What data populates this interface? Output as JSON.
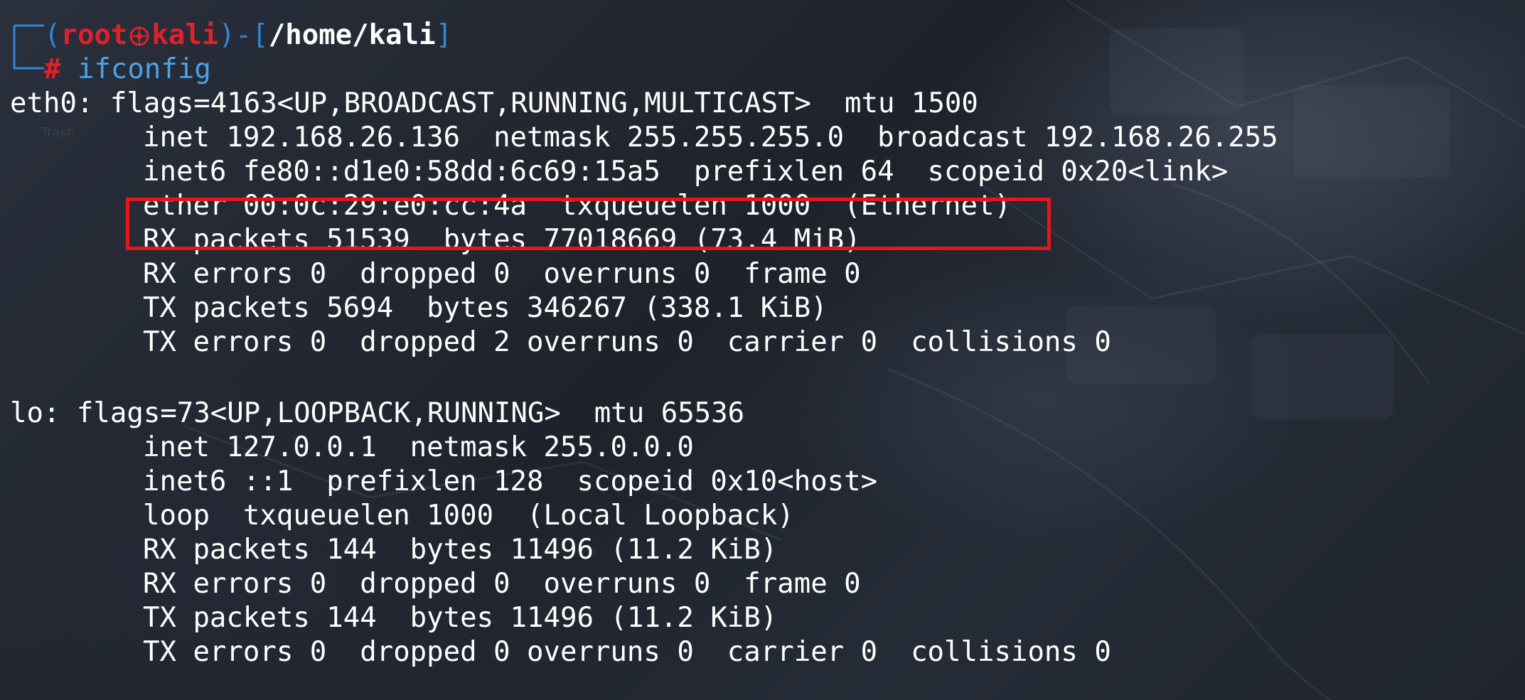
{
  "prompt": {
    "user": "root",
    "separator_icon": "skull-at-icon",
    "host": "kali",
    "cwd": "/home/kali",
    "symbol": "#",
    "command": "ifconfig"
  },
  "output": {
    "eth0": {
      "header": "eth0: flags=4163<UP,BROADCAST,RUNNING,MULTICAST>  mtu 1500",
      "inet": "inet 192.168.26.136  netmask 255.255.255.0  broadcast 192.168.26.255",
      "inet6": "inet6 fe80::d1e0:58dd:6c69:15a5  prefixlen 64  scopeid 0x20<link>",
      "ether": "ether 00:0c:29:e0:cc:4a  txqueuelen 1000  (Ethernet)",
      "rx_packets": "RX packets 51539  bytes 77018669 (73.4 MiB)",
      "rx_errors": "RX errors 0  dropped 0  overruns 0  frame 0",
      "tx_packets": "TX packets 5694  bytes 346267 (338.1 KiB)",
      "tx_errors": "TX errors 0  dropped 2 overruns 0  carrier 0  collisions 0"
    },
    "lo": {
      "header": "lo: flags=73<UP,LOOPBACK,RUNNING>  mtu 65536",
      "inet": "inet 127.0.0.1  netmask 255.0.0.0",
      "inet6": "inet6 ::1  prefixlen 128  scopeid 0x10<host>",
      "loop": "loop  txqueuelen 1000  (Local Loopback)",
      "rx_packets": "RX packets 144  bytes 11496 (11.2 KiB)",
      "rx_errors": "RX errors 0  dropped 0  overruns 0  frame 0",
      "tx_packets": "TX packets 144  bytes 11496 (11.2 KiB)",
      "tx_errors": "TX errors 0  dropped 0 overruns 0  carrier 0  collisions 0"
    }
  },
  "desktop": {
    "trash_label": "Trash"
  },
  "colors": {
    "prompt_frame": "#2f86d6",
    "prompt_user": "#e0212b",
    "command": "#4aa3e8",
    "highlight_box": "#e8141c",
    "text": "#ffffff"
  }
}
